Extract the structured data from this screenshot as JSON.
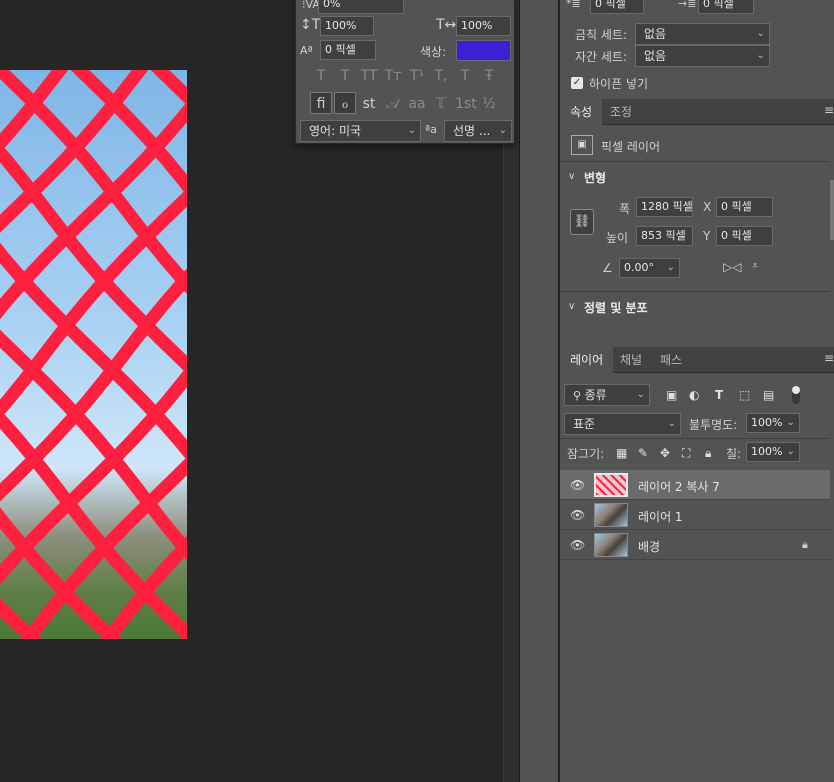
{
  "char_panel": {
    "tracking_value": "0%",
    "vscale_value": "100%",
    "hscale_value": "100%",
    "baseline_value": "0 픽셀",
    "color_label": "색상:",
    "color": "#3a22d4",
    "type_buttons": [
      "T",
      "T",
      "TT",
      "Tт",
      "T¹",
      "T,",
      "T",
      "Ŧ"
    ],
    "ot_buttons": [
      "fi",
      "ℴ",
      "st",
      "𝒜",
      "aa",
      "𝕋",
      "1st",
      "½"
    ],
    "language": "영어: 미국",
    "aa_label": "ªa",
    "antialias": "선명 ..."
  },
  "para_panel": {
    "indent_left": "0 픽셀",
    "indent_right": "0 픽셀",
    "kinsoku_label": "금칙 세트:",
    "kinsoku_value": "없음",
    "mojikumi_label": "자간 세트:",
    "mojikumi_value": "없음",
    "hyphenate_label": "하이픈 넣기"
  },
  "props": {
    "tabs": [
      "속성",
      "조정"
    ],
    "layer_type": "픽셀 레이어",
    "transform_label": "변형",
    "w_label": "폭",
    "w_value": "1280 픽셀",
    "h_label": "높이",
    "h_value": "853 픽셀",
    "x_label": "X",
    "x_value": "0 픽셀",
    "y_label": "Y",
    "y_value": "0 픽셀",
    "angle_value": "0.00°",
    "align_label": "정렬 및 분포"
  },
  "layers": {
    "tabs": [
      "레이어",
      "채널",
      "패스"
    ],
    "filter_kind": "종류",
    "blend_mode": "표준",
    "opacity_label": "불투명도:",
    "opacity_value": "100%",
    "lock_label": "잠그기:",
    "fill_label": "칠:",
    "fill_value": "100%",
    "items": [
      {
        "name": "레이어 2 복사 7",
        "selected": true,
        "thumb": "net"
      },
      {
        "name": "레이어 1",
        "selected": false,
        "thumb": "photo"
      },
      {
        "name": "배경",
        "selected": false,
        "thumb": "photo",
        "locked": true
      }
    ]
  }
}
